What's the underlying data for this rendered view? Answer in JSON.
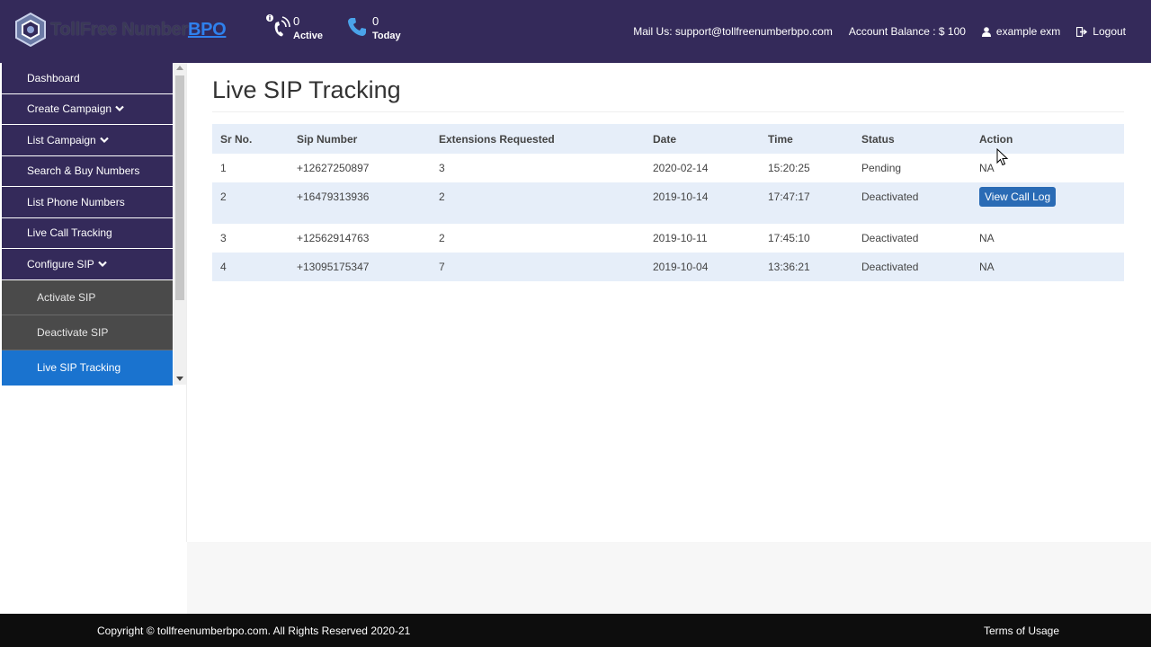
{
  "header": {
    "logo_main": "TollFree Number",
    "logo_bpo": "BPO",
    "active_count": "0",
    "active_label": "Active",
    "today_count": "0",
    "today_label": "Today",
    "mail": "Mail Us: support@tollfreenumberbpo.com",
    "balance": "Account Balance : $ 100",
    "user": "example exm",
    "logout": "Logout"
  },
  "sidebar": {
    "items": [
      {
        "label": "Dashboard"
      },
      {
        "label": "Create Campaign"
      },
      {
        "label": "List Campaign"
      },
      {
        "label": "Search & Buy Numbers"
      },
      {
        "label": "List Phone Numbers"
      },
      {
        "label": "Live Call Tracking"
      },
      {
        "label": "Configure SIP"
      }
    ],
    "sub_items": [
      {
        "label": "Activate SIP"
      },
      {
        "label": "Deactivate SIP"
      },
      {
        "label": "Live SIP Tracking"
      }
    ]
  },
  "page": {
    "title": "Live SIP Tracking"
  },
  "table": {
    "headers": [
      "Sr No.",
      "Sip Number",
      "Extensions Requested",
      "Date",
      "Time",
      "Status",
      "Action"
    ],
    "rows": [
      {
        "sr": "1",
        "sip": "+12627250897",
        "ext": "3",
        "date": "2020-02-14",
        "time": "15:20:25",
        "status": "Pending",
        "action": "NA"
      },
      {
        "sr": "2",
        "sip": "+16479313936",
        "ext": "2",
        "date": "2019-10-14",
        "time": "17:47:17",
        "status": "Deactivated",
        "action": "View Call Log"
      },
      {
        "sr": "3",
        "sip": "+12562914763",
        "ext": "2",
        "date": "2019-10-11",
        "time": "17:45:10",
        "status": "Deactivated",
        "action": "NA"
      },
      {
        "sr": "4",
        "sip": "+13095175347",
        "ext": "7",
        "date": "2019-10-04",
        "time": "13:36:21",
        "status": "Deactivated",
        "action": "NA"
      }
    ]
  },
  "footer": {
    "copyright": "Copyright © tollfreenumberbpo.com. All Rights Reserved 2020-21",
    "terms": "Terms of Usage"
  },
  "colors": {
    "header_bg": "#342a5a",
    "active_nav": "#1a73cf",
    "sub_nav": "#4a4a4a",
    "table_stripe": "#e6eef9",
    "button": "#2a6bb5"
  },
  "icons": {
    "logo": "hexagon-logo-icon",
    "active": "phone-ringing-icon",
    "today": "phone-icon",
    "user": "user-icon",
    "logout": "logout-icon",
    "dropdown": "chevron-down-icon"
  }
}
